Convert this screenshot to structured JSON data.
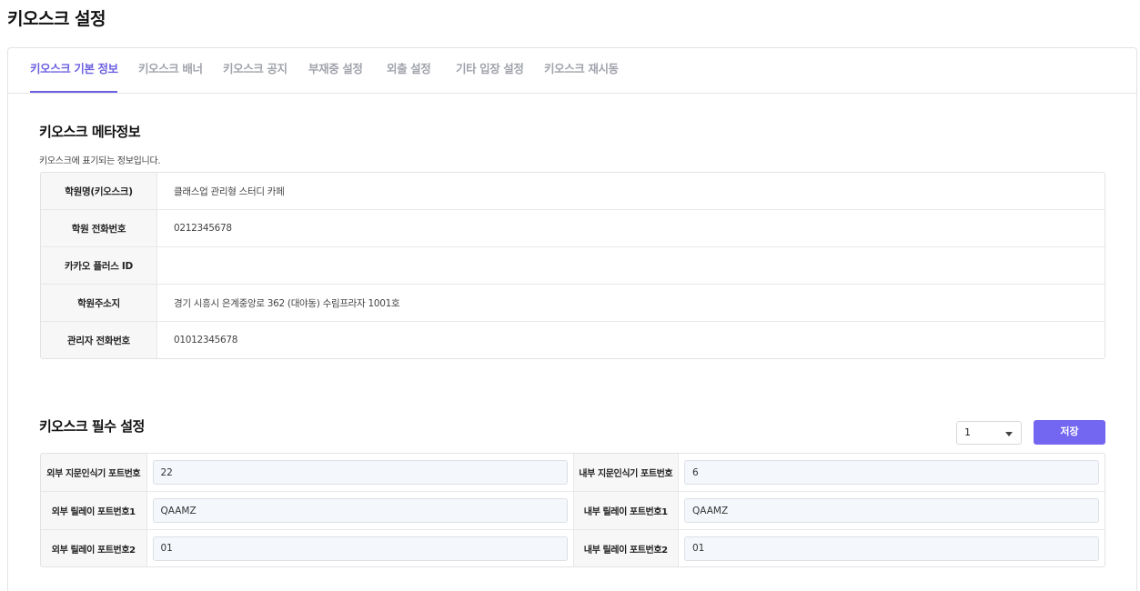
{
  "page": {
    "title": "키오스크 설정"
  },
  "tabs": [
    {
      "label": "키오스크 기본 정보",
      "active": true
    },
    {
      "label": "키오스크 배너",
      "active": false
    },
    {
      "label": "키오스크 공지",
      "active": false
    },
    {
      "label": "부재중 설정",
      "active": false
    },
    {
      "label": "외출 설정",
      "active": false
    },
    {
      "label": "기타 입장 설정",
      "active": false
    },
    {
      "label": "키오스크 재시동",
      "active": false
    }
  ],
  "meta": {
    "title": "키오스크 메타정보",
    "description": "키오스크에 표기되는 정보입니다.",
    "rows": [
      {
        "label": "학원명(키오스크)",
        "value": "클래스업 관리형 스터디 카페"
      },
      {
        "label": "학원 전화번호",
        "value": "0212345678"
      },
      {
        "label": "카카오 플러스 ID",
        "value": ""
      },
      {
        "label": "학원주소지",
        "value": "경기 시흥시 은계중앙로 362 (대야동) 수림프라자 1001호"
      },
      {
        "label": "관리자 전화번호",
        "value": "01012345678"
      }
    ]
  },
  "required": {
    "title": "키오스크 필수 설정",
    "select_value": "1",
    "save_label": "저장",
    "rows": [
      {
        "left_label": "외부 지문인식기 포트번호",
        "left_value": "22",
        "right_label": "내부 지문인식기 포트번호",
        "right_value": "6"
      },
      {
        "left_label": "외부 릴레이 포트번호1",
        "left_value": "QAAMZ",
        "right_label": "내부 릴레이 포트번호1",
        "right_value": "QAAMZ"
      },
      {
        "left_label": "외부 릴레이 포트번호2",
        "left_value": "01",
        "right_label": "내부 릴레이 포트번호2",
        "right_value": "01"
      }
    ]
  },
  "colors": {
    "accent": "#7366f0",
    "tab_active": "#6b60e0",
    "tab_inactive": "#a0a3ab"
  }
}
